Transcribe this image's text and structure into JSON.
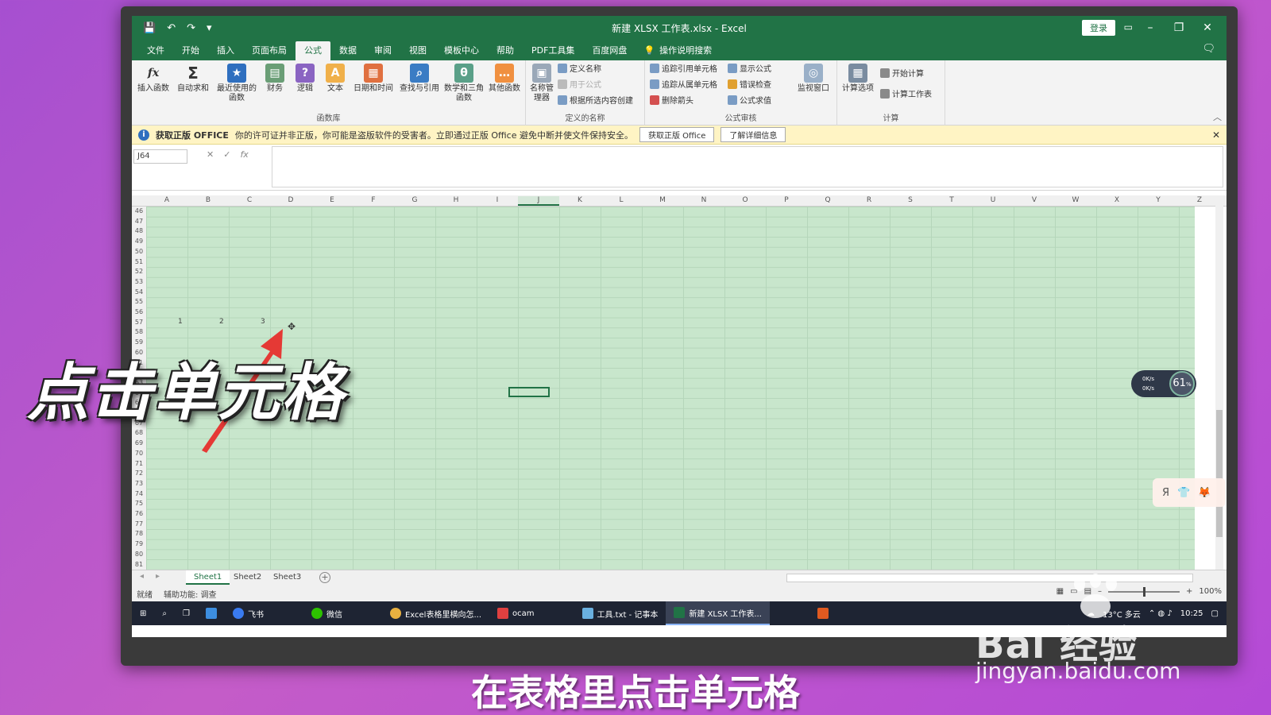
{
  "window": {
    "title": "新建 XLSX 工作表.xlsx - Excel",
    "login": "登录",
    "qat": [
      "💾",
      "↶",
      "↷",
      "▾"
    ]
  },
  "tabs": [
    {
      "label": "文件"
    },
    {
      "label": "开始"
    },
    {
      "label": "插入"
    },
    {
      "label": "页面布局"
    },
    {
      "label": "公式",
      "active": true
    },
    {
      "label": "数据"
    },
    {
      "label": "审阅"
    },
    {
      "label": "视图"
    },
    {
      "label": "模板中心"
    },
    {
      "label": "帮助"
    },
    {
      "label": "PDF工具集"
    },
    {
      "label": "百度网盘"
    }
  ],
  "search": {
    "label": "操作说明搜索"
  },
  "ribbon": {
    "function_library": {
      "label": "函数库",
      "buttons": [
        "插入函数",
        "自动求和",
        "最近使用的函数",
        "财务",
        "逻辑",
        "文本",
        "日期和时间",
        "查找与引用",
        "数学和三角函数",
        "其他函数"
      ]
    },
    "defined_names": {
      "label": "定义的名称",
      "manager": "名称管理器",
      "items": [
        "定义名称",
        "用于公式",
        "根据所选内容创建"
      ]
    },
    "formula_audit": {
      "label": "公式审核",
      "items": [
        "追踪引用单元格",
        "追踪从属单元格",
        "删除箭头",
        "显示公式",
        "错误检查",
        "公式求值"
      ],
      "watch": "监视窗口"
    },
    "calculation": {
      "label": "计算",
      "options": "计算选项",
      "items": [
        "开始计算",
        "计算工作表"
      ]
    }
  },
  "notice": {
    "title": "获取正版 OFFICE",
    "text": "你的许可证并非正版，你可能是盗版软件的受害者。立即通过正版 Office 避免中断并使文件保持安全。",
    "btn1": "获取正版 Office",
    "btn2": "了解详细信息"
  },
  "formula_bar": {
    "namebox": "J64",
    "value": ""
  },
  "grid": {
    "columns": [
      "A",
      "B",
      "C",
      "D",
      "E",
      "F",
      "G",
      "H",
      "I",
      "J",
      "K",
      "L",
      "M",
      "N",
      "O",
      "P",
      "Q",
      "R",
      "S",
      "T",
      "U",
      "V",
      "W",
      "X",
      "Y",
      "Z"
    ],
    "rows": [
      "46",
      "47",
      "48",
      "49",
      "50",
      "51",
      "52",
      "53",
      "54",
      "55",
      "56",
      "57",
      "58",
      "59",
      "60",
      "61",
      "62",
      "63",
      "64",
      "65",
      "66",
      "67",
      "68",
      "69",
      "70",
      "71",
      "72",
      "73",
      "74",
      "75",
      "76",
      "77",
      "78",
      "79",
      "80",
      "81"
    ],
    "cells": [
      {
        "ref": "A57",
        "value": "1"
      },
      {
        "ref": "B57",
        "value": "2"
      },
      {
        "ref": "C57",
        "value": "3"
      }
    ],
    "selected": "J64"
  },
  "sheets": [
    {
      "name": "Sheet1",
      "active": true
    },
    {
      "name": "Sheet2"
    },
    {
      "name": "Sheet3"
    }
  ],
  "status": {
    "ready": "就绪",
    "accessibility": "辅助功能: 调查",
    "zoom": "100%"
  },
  "taskbar": {
    "items": [
      {
        "label": "飞书"
      },
      {
        "label": "微信"
      },
      {
        "label": "Excel表格里横向怎..."
      },
      {
        "label": "ocam"
      },
      {
        "label": "工具.txt - 记事本"
      },
      {
        "label": "新建 XLSX 工作表...",
        "active": true
      }
    ],
    "weather": "13°C 多云",
    "clock": "10:25"
  },
  "net_widget": {
    "up": "0K/s",
    "down": "0K/s",
    "percent": "61"
  },
  "overlay": {
    "title": "点击单元格",
    "subtitle": "在表格里点击单元格",
    "watermark_logo": "Bai 经验",
    "watermark_url": "jingyan.baidu.com"
  },
  "colors": {
    "excel_green": "#217346",
    "grid_bg": "#c8e6cc",
    "arrow": "#e53935"
  }
}
